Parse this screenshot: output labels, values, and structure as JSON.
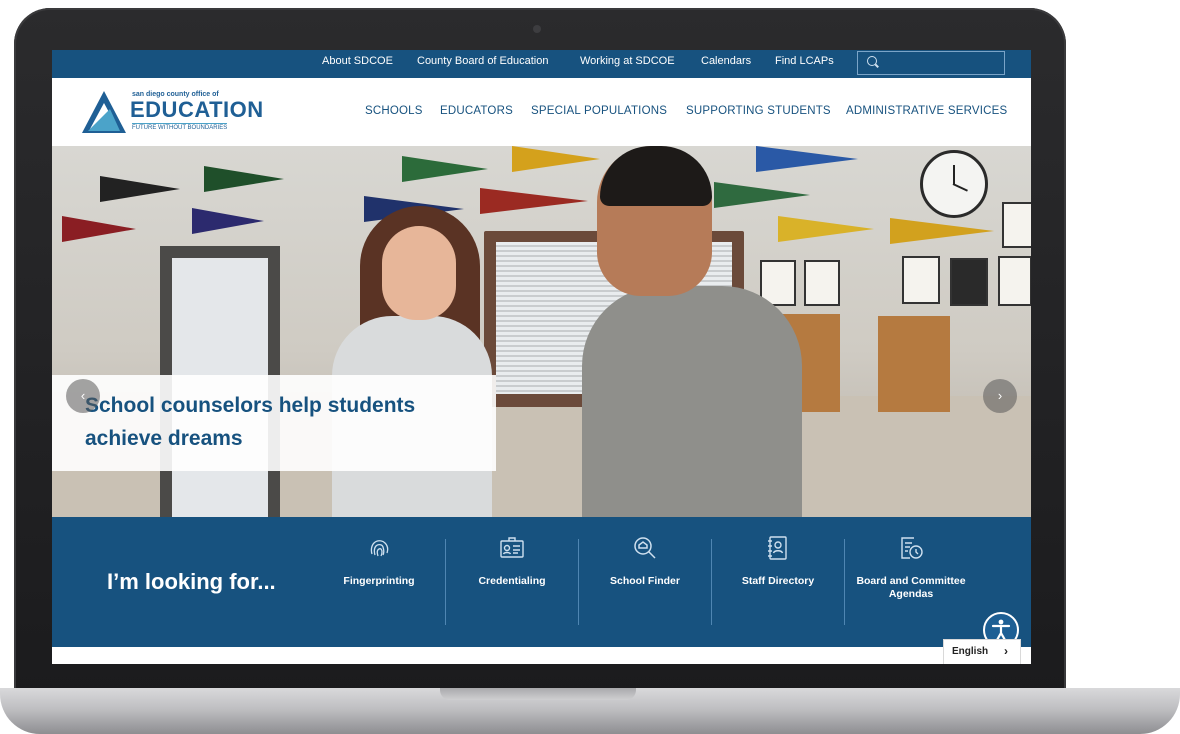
{
  "utility_nav": {
    "links": [
      "About SDCOE",
      "County Board of Education",
      "Working at SDCOE",
      "Calendars",
      "Find LCAPs"
    ],
    "search_placeholder": ""
  },
  "logo": {
    "small_text": "san diego county office of",
    "main_text": "EDUCATION",
    "tagline": "FUTURE WITHOUT BOUNDARIES"
  },
  "main_nav": {
    "items": [
      "SCHOOLS",
      "EDUCATORS",
      "SPECIAL POPULATIONS",
      "SUPPORTING STUDENTS",
      "ADMINISTRATIVE SERVICES"
    ]
  },
  "hero": {
    "caption_line1": "School counselors help students",
    "caption_line2": "achieve dreams",
    "prev_arrow": "‹",
    "next_arrow": "›"
  },
  "quick_links": {
    "heading": "I’m looking for...",
    "items": [
      {
        "label": "Fingerprinting",
        "icon": "fingerprint-icon"
      },
      {
        "label": "Credentialing",
        "icon": "id-card-icon"
      },
      {
        "label": "School Finder",
        "icon": "school-search-icon"
      },
      {
        "label": "Staff Directory",
        "icon": "directory-icon"
      },
      {
        "label": "Board and Committee Agendas",
        "icon": "agenda-clock-icon"
      }
    ]
  },
  "language": {
    "selected": "English",
    "chevron": "›"
  },
  "colors": {
    "brand_blue": "#17527f",
    "accent_teal": "#4ba3c9"
  }
}
